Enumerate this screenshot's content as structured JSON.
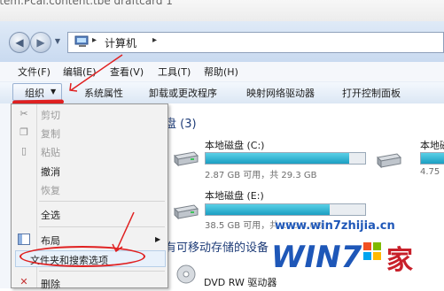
{
  "top_text": "ltem.Pcal.content.tbe  draftcard   1",
  "address": {
    "path_label": "计算机",
    "separator": "▸"
  },
  "menu_bar": [
    {
      "label": "文件(F)"
    },
    {
      "label": "编辑(E)"
    },
    {
      "label": "查看(V)"
    },
    {
      "label": "工具(T)"
    },
    {
      "label": "帮助(H)"
    }
  ],
  "command_bar": {
    "organize_label": "组织",
    "organize_arrow": "▼",
    "items": [
      {
        "label": "系统属性"
      },
      {
        "label": "卸载或更改程序"
      },
      {
        "label": "映射网络驱动器"
      },
      {
        "label": "打开控制面板"
      }
    ]
  },
  "content": {
    "section_title": "盘 (3)",
    "drives": [
      {
        "label": "本地磁盘 (C:)",
        "info": "2.87 GB 可用，共 29.3 GB",
        "fill": 0.9
      },
      {
        "label": "本地磁盘 (E:)",
        "info": "38.5 GB 可用，共 176.8 GB",
        "fill": 0.78
      }
    ],
    "right_drive_label": "本地磁",
    "right_drive_info": "4.75",
    "removable_title": "有可移动存储的设备",
    "dvd_label": "DVD RW 驱动器"
  },
  "context_menu": {
    "items": [
      {
        "label": "剪切",
        "disabled": true
      },
      {
        "label": "复制",
        "disabled": true
      },
      {
        "label": "粘贴",
        "disabled": true
      },
      {
        "label": "撤消",
        "disabled": false
      },
      {
        "label": "恢复",
        "disabled": true
      },
      {
        "label": "全选",
        "disabled": false
      },
      {
        "label": "布局",
        "disabled": false,
        "submenu_arrow": "▶"
      },
      {
        "label": "文件夹和搜索选项",
        "disabled": false
      },
      {
        "label": "删除",
        "disabled": false
      }
    ]
  },
  "watermark": {
    "url": "www.win7zhijia.cn",
    "logo_text": "WIN7",
    "logo_suffix": "之家"
  },
  "colors": {
    "annotation_red": "#e02020",
    "progress_fill": "#1b9fc2",
    "watermark_blue": "#1e57b8"
  }
}
